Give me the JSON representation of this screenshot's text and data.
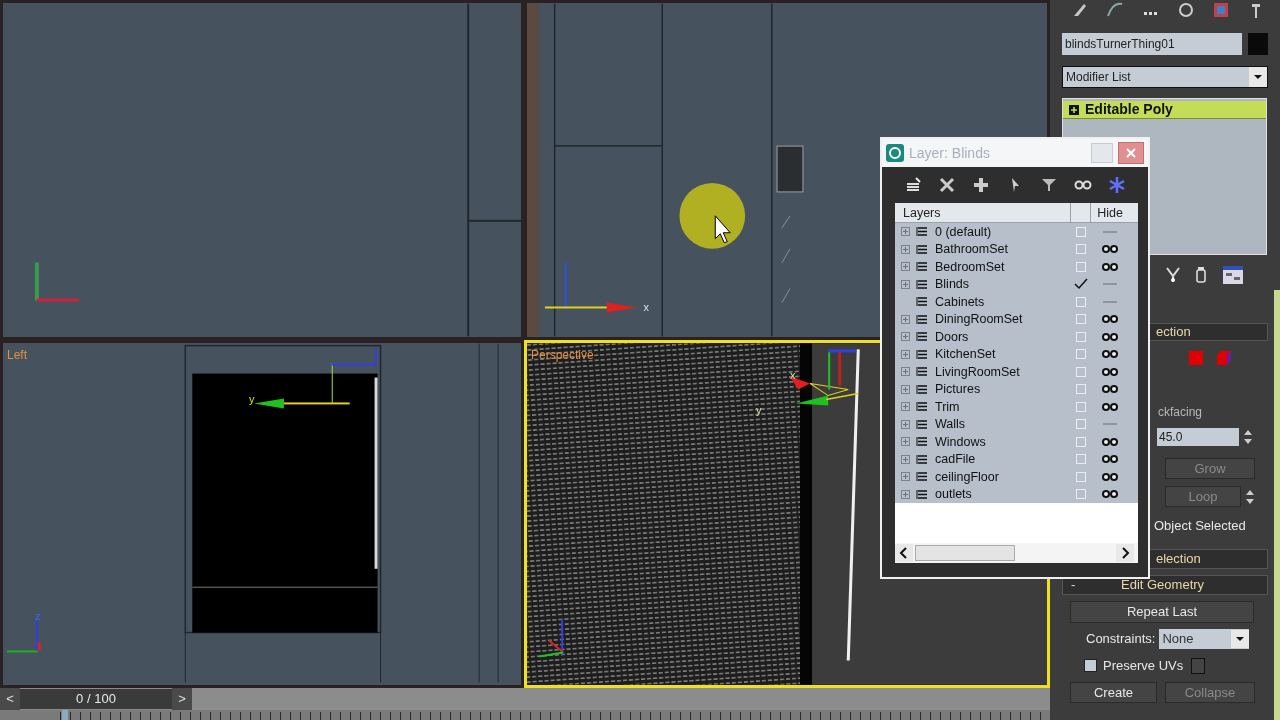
{
  "viewports": [
    {
      "kind": "top",
      "active": false
    },
    {
      "kind": "front",
      "active": false,
      "axis_labels": [
        "x"
      ]
    },
    {
      "kind": "left",
      "label": "Left",
      "active": false,
      "axis_labels": [
        "y",
        "z"
      ]
    },
    {
      "kind": "perspective",
      "label": "Perspective",
      "active": true,
      "axis_labels": [
        "x",
        "y"
      ]
    }
  ],
  "timeline": {
    "prev": "<",
    "frame": "0 / 100",
    "next": ">"
  },
  "command_panel": {
    "object_name": "blindsTurnerThing01",
    "modifier_list": "Modifier List",
    "stack": [
      {
        "label": "Editable Poly",
        "selected": true
      }
    ],
    "selection_rollout": {
      "title": "ection",
      "facing_label": "ckfacing",
      "angle": "45.0",
      "grow": {
        "label": "Grow",
        "disabled": true
      },
      "loop": {
        "label": "Loop",
        "disabled": true
      },
      "status": "Object Selected"
    },
    "soft_selection_rollout": {
      "title": "election"
    },
    "edit_geometry": {
      "collapse_sign": "-",
      "title": "Edit Geometry",
      "repeat_last": {
        "label": "Repeat Last",
        "disabled": false
      },
      "constraints_label": "Constraints:",
      "constraints_value": "None",
      "preserve_uvs": {
        "label": "Preserve UVs",
        "checked": false
      },
      "create": {
        "label": "Create",
        "disabled": false
      },
      "collapse": {
        "label": "Collapse",
        "disabled": true
      }
    }
  },
  "layer_dialog": {
    "title": "Layer: Blinds",
    "column_headers": {
      "name": "Layers",
      "hide": "Hide"
    },
    "layers": [
      {
        "name": "0 (default)",
        "expandable": true,
        "current": false,
        "hidden": true
      },
      {
        "name": "BathroomSet",
        "expandable": true,
        "current": false,
        "hidden": false
      },
      {
        "name": "BedroomSet",
        "expandable": true,
        "current": false,
        "hidden": false
      },
      {
        "name": "Blinds",
        "expandable": true,
        "current": true,
        "hidden": true
      },
      {
        "name": "Cabinets",
        "expandable": false,
        "current": false,
        "hidden": true
      },
      {
        "name": "DiningRoomSet",
        "expandable": true,
        "current": false,
        "hidden": false
      },
      {
        "name": "Doors",
        "expandable": true,
        "current": false,
        "hidden": false
      },
      {
        "name": "KitchenSet",
        "expandable": true,
        "current": false,
        "hidden": false
      },
      {
        "name": "LivingRoomSet",
        "expandable": true,
        "current": false,
        "hidden": false
      },
      {
        "name": "Pictures",
        "expandable": true,
        "current": false,
        "hidden": false
      },
      {
        "name": "Trim",
        "expandable": true,
        "current": false,
        "hidden": false
      },
      {
        "name": "Walls",
        "expandable": true,
        "current": false,
        "hidden": true
      },
      {
        "name": "Windows",
        "expandable": true,
        "current": false,
        "hidden": false
      },
      {
        "name": "cadFile",
        "expandable": true,
        "current": false,
        "hidden": false
      },
      {
        "name": "ceilingFloor",
        "expandable": true,
        "current": false,
        "hidden": false
      },
      {
        "name": "outlets",
        "expandable": true,
        "current": false,
        "hidden": false
      }
    ]
  }
}
